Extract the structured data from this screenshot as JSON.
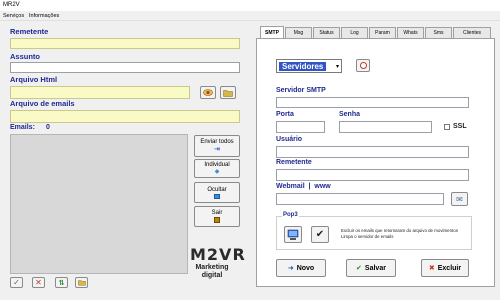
{
  "window": {
    "title": "MR2V"
  },
  "menu": {
    "items": [
      "Serviços",
      "Informações"
    ]
  },
  "left": {
    "remetente_label": "Remetente",
    "assunto_label": "Assunto",
    "arquivo_html_label": "Arquivo Html",
    "arquivo_emails_label": "Arquivo de emails",
    "emails_label": "Emails:",
    "emails_count": "0",
    "buttons": {
      "enviar_todos": "Enviar todos",
      "individual": "Individual",
      "ocultar": "Ocultar",
      "sair": "Sair"
    }
  },
  "logo": {
    "text": "M2VR",
    "line1": "Marketing",
    "line2": "digital"
  },
  "tabs": [
    "SMTP",
    "Msg",
    "Status",
    "Log",
    "Param",
    "Whats",
    "Sms",
    "Clientes"
  ],
  "smtp": {
    "server_select": "Servidores",
    "servidor_smtp_label": "Servidor SMTP",
    "porta_label": "Porta",
    "senha_label": "Senha",
    "ssl_label": "SSL",
    "usuario_label": "Usuário",
    "remetente_label": "Remetente",
    "webmail_label": "Webmail  |  www",
    "pop3_label": "Pop3",
    "pop3_desc_line1": "Excluir os emails que retornaram do arquivo de movimentos",
    "pop3_desc_line2": "Limpa o servidor de emails",
    "buttons": {
      "novo": "Novo",
      "salvar": "Salvar",
      "excluir": "Excluir"
    }
  },
  "colors": {
    "label_blue": "#1f2a8f",
    "yellow_input": "#fafac6",
    "select_blue": "#3154c4"
  }
}
